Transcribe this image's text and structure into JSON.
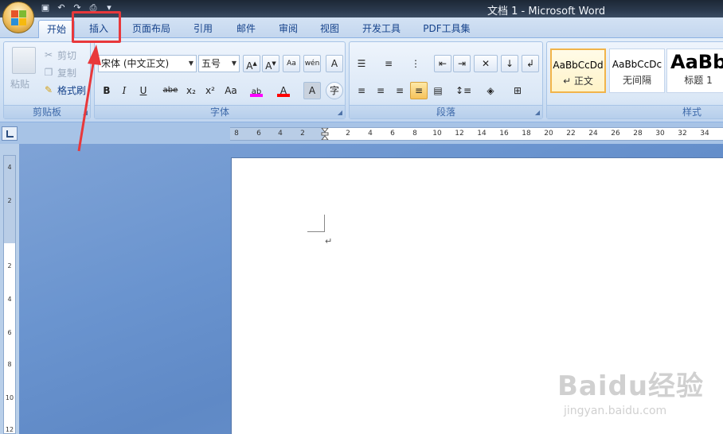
{
  "window": {
    "title": "文档 1 - Microsoft Word"
  },
  "qat": {
    "icons": [
      "save-icon",
      "undo-icon",
      "redo-icon",
      "print-icon",
      "customize-icon"
    ]
  },
  "tabs": [
    {
      "label": "开始",
      "active": true
    },
    {
      "label": "插入",
      "active": false,
      "highlighted": true
    },
    {
      "label": "页面布局",
      "active": false
    },
    {
      "label": "引用",
      "active": false
    },
    {
      "label": "邮件",
      "active": false
    },
    {
      "label": "审阅",
      "active": false
    },
    {
      "label": "视图",
      "active": false
    },
    {
      "label": "开发工具",
      "active": false
    },
    {
      "label": "PDF工具集",
      "active": false
    }
  ],
  "clipboard": {
    "paste_label": "粘贴",
    "cut_label": "剪切",
    "copy_label": "复制",
    "format_painter_label": "格式刷",
    "group_label": "剪贴板"
  },
  "font": {
    "font_name": "宋体 (中文正文)",
    "font_size": "五号",
    "group_label": "字体",
    "format_buttons": [
      "B",
      "I",
      "U",
      "abe",
      "x₂",
      "x²",
      "Aa"
    ],
    "highlight_color": "#ff00ff",
    "font_color": "#ff0000"
  },
  "paragraph": {
    "group_label": "段落"
  },
  "styles": {
    "group_label": "样式",
    "items": [
      {
        "sample": "AaBbCcDd",
        "name": "↵ 正文",
        "selected": true
      },
      {
        "sample": "AaBbCcDc",
        "name": "无间隔",
        "selected": false
      },
      {
        "sample": "AaBb",
        "name": "标题 1",
        "selected": false
      }
    ]
  },
  "ruler": {
    "h_labels": [
      "8",
      "6",
      "4",
      "2",
      "2",
      "4",
      "6",
      "8",
      "10",
      "12",
      "14",
      "16",
      "18",
      "20",
      "22",
      "24",
      "26",
      "28",
      "30",
      "32",
      "34"
    ],
    "v_labels": [
      "4",
      "2",
      "2",
      "4",
      "6",
      "8",
      "10",
      "12"
    ]
  },
  "document": {
    "paragraph_mark": "↵"
  },
  "watermark": {
    "brand": "Baidu经验",
    "url": "jingyan.baidu.com"
  },
  "annotation": {
    "highlight_color": "#e8383b"
  }
}
